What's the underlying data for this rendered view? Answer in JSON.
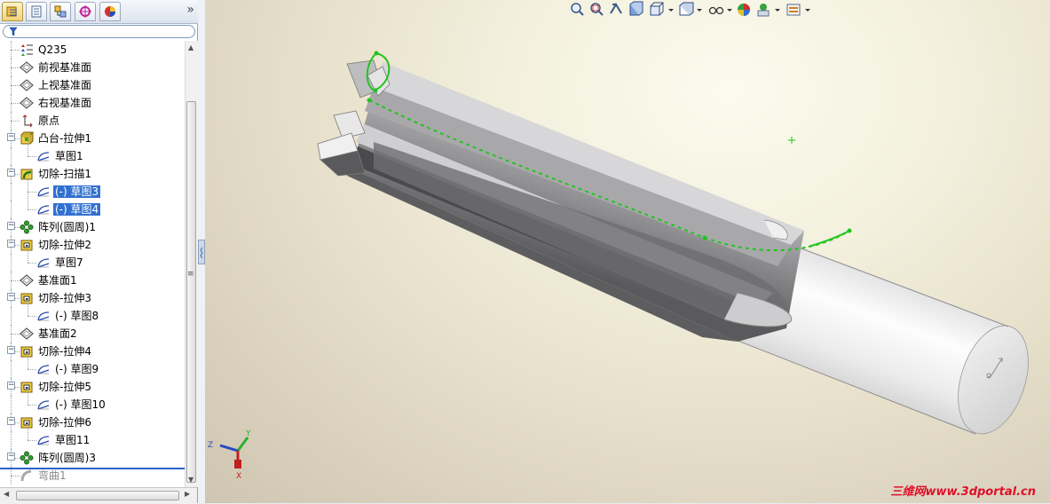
{
  "feature_tree": {
    "items": [
      {
        "label": "Q235",
        "icon": "material-icon",
        "expandable": false,
        "selected": false,
        "dimmed": false
      },
      {
        "label": "前视基准面",
        "icon": "plane-icon",
        "expandable": false,
        "selected": false,
        "dimmed": false
      },
      {
        "label": "上视基准面",
        "icon": "plane-icon",
        "expandable": false,
        "selected": false,
        "dimmed": false
      },
      {
        "label": "右视基准面",
        "icon": "plane-icon",
        "expandable": false,
        "selected": false,
        "dimmed": false
      },
      {
        "label": "原点",
        "icon": "origin-icon",
        "expandable": false,
        "selected": false,
        "dimmed": false
      },
      {
        "label": "凸台-拉伸1",
        "icon": "boss-extrude-icon",
        "expandable": true,
        "selected": false,
        "dimmed": false
      },
      {
        "label": "草图1",
        "icon": "sketch-icon",
        "expandable": false,
        "selected": false,
        "dimmed": false
      },
      {
        "label": "切除-扫描1",
        "icon": "cut-sweep-icon",
        "expandable": true,
        "selected": false,
        "dimmed": false
      },
      {
        "label": "(-) 草图3",
        "icon": "sketch-icon",
        "expandable": false,
        "selected": true,
        "dimmed": false
      },
      {
        "label": "(-) 草图4",
        "icon": "sketch-icon",
        "expandable": false,
        "selected": true,
        "dimmed": false
      },
      {
        "label": "阵列(圆周)1",
        "icon": "circular-pattern-icon",
        "expandable": true,
        "selected": false,
        "dimmed": false
      },
      {
        "label": "切除-拉伸2",
        "icon": "cut-extrude-icon",
        "expandable": true,
        "selected": false,
        "dimmed": false
      },
      {
        "label": "草图7",
        "icon": "sketch-icon",
        "expandable": false,
        "selected": false,
        "dimmed": false
      },
      {
        "label": "基准面1",
        "icon": "plane-icon",
        "expandable": false,
        "selected": false,
        "dimmed": false
      },
      {
        "label": "切除-拉伸3",
        "icon": "cut-extrude-icon",
        "expandable": true,
        "selected": false,
        "dimmed": false
      },
      {
        "label": "(-) 草图8",
        "icon": "sketch-icon",
        "expandable": false,
        "selected": false,
        "dimmed": false
      },
      {
        "label": "基准面2",
        "icon": "plane-icon",
        "expandable": false,
        "selected": false,
        "dimmed": false
      },
      {
        "label": "切除-拉伸4",
        "icon": "cut-extrude-icon",
        "expandable": true,
        "selected": false,
        "dimmed": false
      },
      {
        "label": "(-) 草图9",
        "icon": "sketch-icon",
        "expandable": false,
        "selected": false,
        "dimmed": false
      },
      {
        "label": "切除-拉伸5",
        "icon": "cut-extrude-icon",
        "expandable": true,
        "selected": false,
        "dimmed": false
      },
      {
        "label": "(-) 草图10",
        "icon": "sketch-icon",
        "expandable": false,
        "selected": false,
        "dimmed": false
      },
      {
        "label": "切除-拉伸6",
        "icon": "cut-extrude-icon",
        "expandable": true,
        "selected": false,
        "dimmed": false
      },
      {
        "label": "草图11",
        "icon": "sketch-icon",
        "expandable": false,
        "selected": false,
        "dimmed": false
      },
      {
        "label": "阵列(圆周)3",
        "icon": "circular-pattern-icon",
        "expandable": true,
        "selected": false,
        "dimmed": false
      },
      {
        "label": "弯曲1",
        "icon": "flex-icon",
        "expandable": false,
        "selected": false,
        "dimmed": true
      }
    ]
  },
  "manager_tabs": [
    {
      "icon": "feature-manager-icon",
      "active": true
    },
    {
      "icon": "property-manager-icon",
      "active": false
    },
    {
      "icon": "configuration-manager-icon",
      "active": false
    },
    {
      "icon": "dimxpert-manager-icon",
      "active": false
    },
    {
      "icon": "display-manager-icon",
      "active": false
    }
  ],
  "view_toolbar": {
    "icons": [
      "zoom-to-fit-icon",
      "zoom-to-area-icon",
      "previous-view-icon",
      "section-view-icon",
      "view-orientation-icon",
      "display-style-icon",
      "hide-show-items-icon",
      "edit-appearance-icon",
      "apply-scene-icon",
      "view-settings-icon"
    ]
  },
  "triad": {
    "x_label": "X",
    "y_label": "Y",
    "z_label": "Z"
  },
  "watermark": {
    "text": "三维网www.3dportal.cn"
  },
  "colors": {
    "selection": "#3170d0",
    "sketch_green": "#22c41f",
    "watermark_red": "#e0102a"
  }
}
